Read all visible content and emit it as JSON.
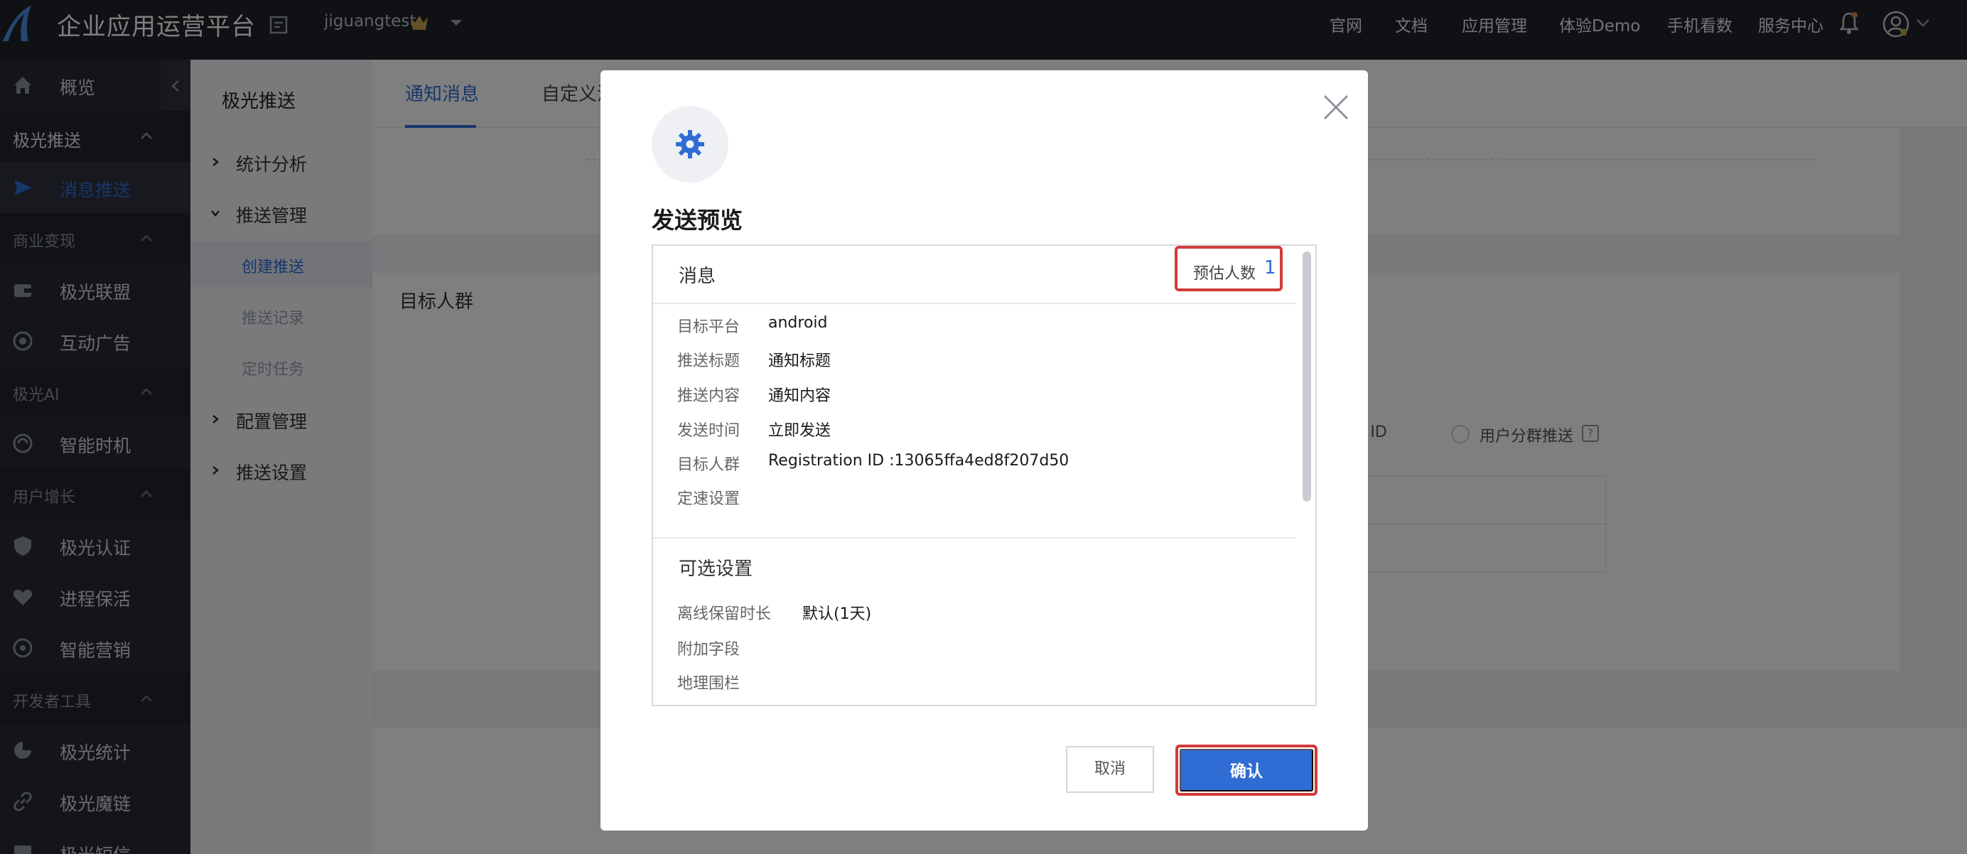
{
  "header": {
    "app_title": "企业应用运营平台",
    "account": "jiguangtest",
    "nav": [
      "官网",
      "文档",
      "应用管理",
      "体验Demo",
      "手机看数",
      "服务中心"
    ]
  },
  "sidebar": {
    "items": [
      {
        "type": "item",
        "label": "概览",
        "icon": "home-icon"
      },
      {
        "type": "group",
        "label": "极光推送"
      },
      {
        "type": "item",
        "label": "消息推送",
        "icon": "send-icon",
        "active": true
      },
      {
        "type": "group",
        "label": "商业变现"
      },
      {
        "type": "item",
        "label": "极光联盟",
        "icon": "wallet-icon"
      },
      {
        "type": "item",
        "label": "互动广告",
        "icon": "ad-icon"
      },
      {
        "type": "group",
        "label": "极光AI"
      },
      {
        "type": "item",
        "label": "智能时机",
        "icon": "ai-icon"
      },
      {
        "type": "group",
        "label": "用户增长"
      },
      {
        "type": "item",
        "label": "极光认证",
        "icon": "shield-icon"
      },
      {
        "type": "item",
        "label": "进程保活",
        "icon": "heart-icon"
      },
      {
        "type": "item",
        "label": "智能营销",
        "icon": "target-icon"
      },
      {
        "type": "group",
        "label": "开发者工具"
      },
      {
        "type": "item",
        "label": "极光统计",
        "icon": "chart-icon"
      },
      {
        "type": "item",
        "label": "极光魔链",
        "icon": "link-icon"
      },
      {
        "type": "item",
        "label": "极光短信",
        "icon": "sms-icon"
      }
    ]
  },
  "subnav": {
    "title": "极光推送",
    "items": [
      "统计分析",
      "推送管理",
      "创建推送",
      "推送记录",
      "定时任务",
      "配置管理",
      "推送设置"
    ]
  },
  "main": {
    "tabs": [
      "通知消息",
      "自定义消息"
    ],
    "target_label": "目标人群",
    "registration_partial": "on ID",
    "segment_option": "用户分群推送",
    "help": "?"
  },
  "modal": {
    "title": "发送预览",
    "estimate_label": "预估人数",
    "estimate_value": "1",
    "message_section": "消息",
    "rows": [
      {
        "label": "目标平台",
        "value": "android"
      },
      {
        "label": "推送标题",
        "value": "通知标题"
      },
      {
        "label": "推送内容",
        "value": "通知内容"
      },
      {
        "label": "发送时间",
        "value": "立即发送"
      },
      {
        "label": "目标人群",
        "value": "Registration ID :13065ffa4ed8f207d50"
      },
      {
        "label": "定速设置",
        "value": ""
      }
    ],
    "optional_section": "可选设置",
    "optional_rows": [
      {
        "label": "离线保留时长",
        "value": "默认(1天)"
      },
      {
        "label": "附加字段",
        "value": ""
      },
      {
        "label": "地理围栏",
        "value": ""
      }
    ],
    "cancel_label": "取消",
    "confirm_label": "确认",
    "accent_color": "#2f6cd4",
    "highlight_color": "#d33a3a"
  }
}
